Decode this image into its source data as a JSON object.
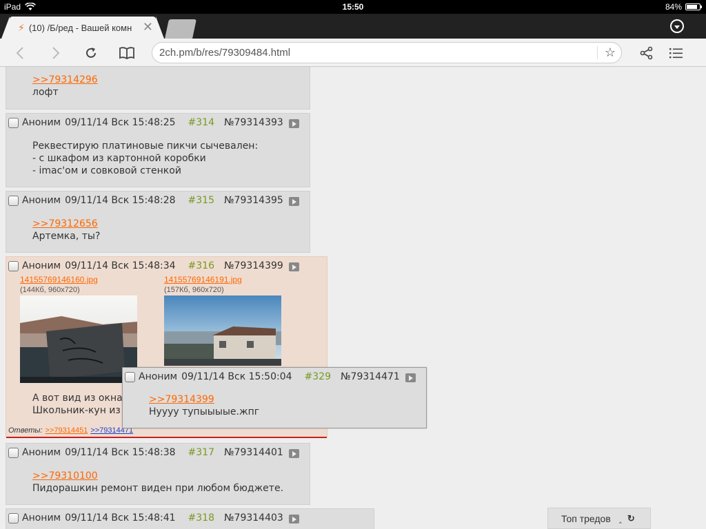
{
  "status_bar": {
    "device": "iPad",
    "time": "15:50",
    "battery": "84%",
    "battery_level": 0.84
  },
  "browser": {
    "tab_title": "(10) /Б/ред - Вашей комн",
    "url": "2ch.pm/b/res/79309484.html",
    "icons": {
      "back": "chevron-left-icon",
      "forward": "chevron-right-icon",
      "reload": "reload-icon",
      "reader": "book-icon",
      "bookmark": "star-icon",
      "share": "share-icon",
      "menu": "list-icon",
      "tabs_menu": "chevron-down-circle-icon",
      "tab_close": "close-icon"
    }
  },
  "posts": [
    {
      "id": "partial",
      "reply_link": ">>79314296",
      "text": "лофт"
    },
    {
      "name": "Аноним",
      "date": "09/11/14 Вск 15:48:25",
      "num": "#314",
      "post_id": "№79314393",
      "text": "Реквестирую платиновые пикчи сычевален:\n- с шкафом из картонной коробки\n- imac'ом и совковой стенкой"
    },
    {
      "name": "Аноним",
      "date": "09/11/14 Вск 15:48:28",
      "num": "#315",
      "post_id": "№79314395",
      "reply_link": ">>79312656",
      "text": "Артемка, ты?"
    },
    {
      "name": "Аноним",
      "date": "09/11/14 Вск 15:48:34",
      "num": "#316",
      "post_id": "№79314399",
      "files": [
        {
          "name": "14155769146160.jpg",
          "info": "(144Кб, 960x720)"
        },
        {
          "name": "14155769146191.jpg",
          "info": "(157Кб, 960x720)"
        }
      ],
      "text": "А вот вид из окна\nШкольник-кун из",
      "replies_label": "Ответы:",
      "replies": [
        ">>79314451",
        ">>79314471"
      ]
    },
    {
      "name": "Аноним",
      "date": "09/11/14 Вск 15:48:38",
      "num": "#317",
      "post_id": "№79314401",
      "reply_link": ">>79310100",
      "text": "Пидорашкин ремонт виден при любом бюджете."
    },
    {
      "name": "Аноним",
      "date": "09/11/14 Вск 15:48:41",
      "num": "#318",
      "post_id": "№79314403"
    }
  ],
  "popup": {
    "name": "Аноним",
    "date": "09/11/14 Вск 15:50:04",
    "num": "#329",
    "post_id": "№79314471",
    "reply_link": ">>79314399",
    "text": "Нуууу тупыыыые.жпг"
  },
  "top_threads": {
    "label": "Топ тредов"
  },
  "colors": {
    "post_bg": "#dddddd",
    "highlight_bg": "#efdcd0",
    "post_num": "#789922",
    "link": "#ff6600",
    "visited_link": "#1a3fcc"
  }
}
